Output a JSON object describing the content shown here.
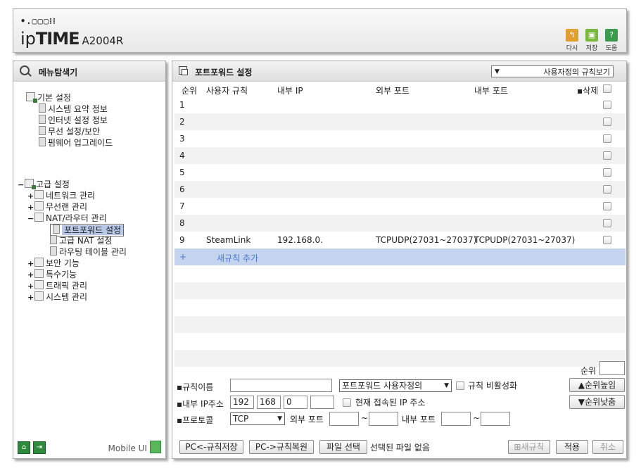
{
  "header": {
    "brand_top": "•.▢▢▢⁝⁝",
    "brand_ip": "ip",
    "brand_time": "TIME",
    "model": "A2004R",
    "icons": [
      {
        "name": "refresh-icon",
        "label": "다시",
        "color": "#e0a030"
      },
      {
        "name": "save-icon",
        "label": "저장",
        "color": "#78b83c"
      },
      {
        "name": "help-icon",
        "label": "도움",
        "color": "#3c9a4c"
      }
    ]
  },
  "sidebar": {
    "title": "메뉴탐색기",
    "basic": {
      "label": "기본 설정",
      "items": [
        "시스템 요약 정보",
        "인터넷 설정 정보",
        "무선 설정/보안",
        "펌웨어 업그레이드"
      ]
    },
    "advanced": {
      "toggle": "−",
      "label": "고급 설정",
      "groups": [
        {
          "toggle": "+",
          "label": "네트워크 관리"
        },
        {
          "toggle": "+",
          "label": "무선랜 관리"
        },
        {
          "toggle": "−",
          "label": "NAT/라우터 관리"
        }
      ],
      "nat_items": [
        "포트포워드 설정",
        "고급 NAT 설정",
        "라우팅 테이블 관리"
      ],
      "more_groups": [
        {
          "toggle": "+",
          "label": "보안 기능"
        },
        {
          "toggle": "+",
          "label": "특수기능"
        },
        {
          "toggle": "+",
          "label": "트래픽 관리"
        },
        {
          "toggle": "+",
          "label": "시스템 관리"
        }
      ]
    },
    "mobile_label": "Mobile UI"
  },
  "main": {
    "title": "포트포워드 설정",
    "view_select": "사용자정의 규칙보기",
    "columns": {
      "order": "순위",
      "rule": "사용자 규칙",
      "internal_ip": "내부 IP",
      "external_port": "외부 포트",
      "internal_port": "내부 포트",
      "delete": "삭제"
    },
    "rows": [
      {
        "order": "1",
        "rule": "",
        "ip": "",
        "ext": "",
        "int": ""
      },
      {
        "order": "2",
        "rule": "",
        "ip": "",
        "ext": "",
        "int": ""
      },
      {
        "order": "3",
        "rule": "",
        "ip": "",
        "ext": "",
        "int": ""
      },
      {
        "order": "4",
        "rule": "",
        "ip": "",
        "ext": "",
        "int": ""
      },
      {
        "order": "5",
        "rule": "",
        "ip": "",
        "ext": "",
        "int": ""
      },
      {
        "order": "6",
        "rule": "",
        "ip": "",
        "ext": "",
        "int": ""
      },
      {
        "order": "7",
        "rule": "",
        "ip": "",
        "ext": "",
        "int": ""
      },
      {
        "order": "8",
        "rule": "",
        "ip": "",
        "ext": "",
        "int": ""
      },
      {
        "order": "9",
        "rule": "SteamLink",
        "ip": "192.168.0.",
        "ext": "TCPUDP(27031~27037)",
        "int": "TCPUDP(27031~27037)"
      }
    ],
    "add_rule": {
      "plus": "+",
      "label": "새규칙 추가"
    },
    "form": {
      "order_label": "순위",
      "order_value": "",
      "rule_name_label": "규칙이름",
      "rule_name_value": "",
      "rule_type_select": "포트포워드 사용자정의",
      "disable_label": "규칙 비활성화",
      "priority_up": "▲순위높임",
      "priority_down": "▼순위낮춤",
      "ip_label": "내부 IP주소",
      "ip1": "192",
      "ip2": "168",
      "ip3": "0",
      "ip4": "",
      "current_ip_label": "현재 접속된 IP 주소",
      "protocol_label": "프로토콜",
      "protocol_value": "TCP",
      "ext_port_label": "외부 포트",
      "int_port_label": "내부 포트",
      "tilde": "~"
    },
    "buttons": {
      "pc_save": "PC<-규칙저장",
      "pc_restore": "PC->규칙복원",
      "file_select": "파일 선택",
      "no_file": "선택된 파일 없음",
      "new_rule": "새규칙",
      "apply": "적용",
      "cancel": "취소"
    }
  }
}
